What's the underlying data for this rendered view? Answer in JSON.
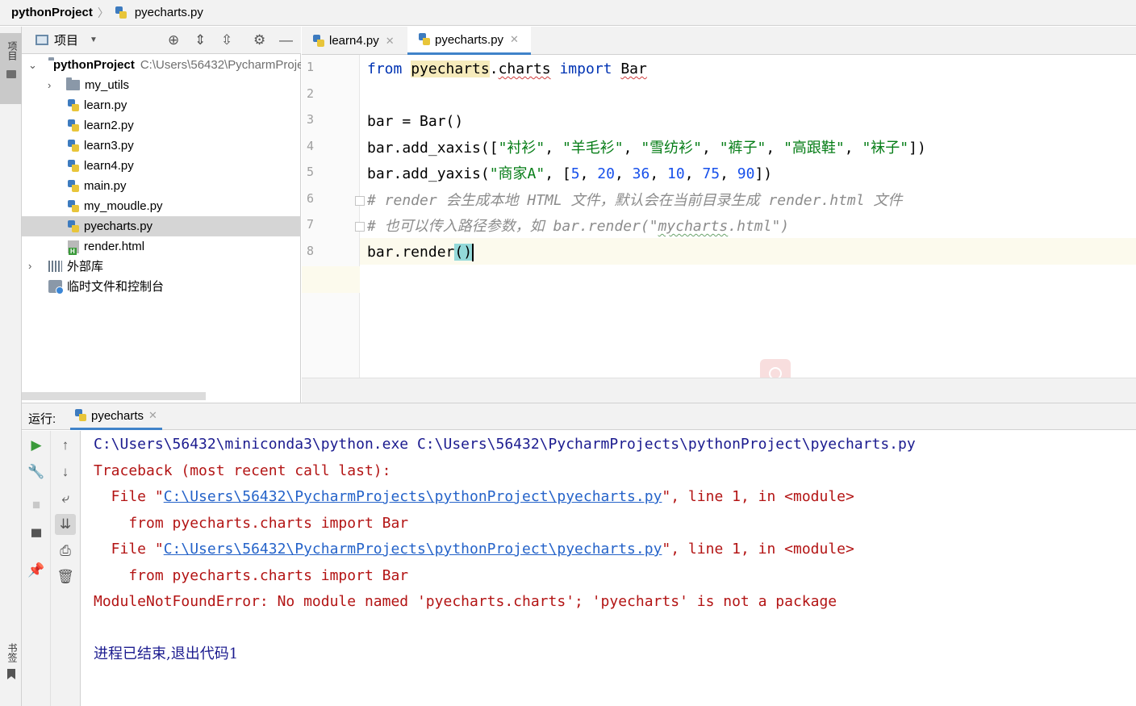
{
  "breadcrumb": {
    "project": "pythonProject",
    "file": "pyecharts.py"
  },
  "left_stripe": {
    "project_label": "项目",
    "bookmarks_label": "书签"
  },
  "project_panel": {
    "title": "项目",
    "tree": [
      {
        "label": "pythonProject",
        "path": "C:\\Users\\56432\\PycharmProjects\\pythonProject",
        "kind": "root"
      },
      {
        "label": "my_utils",
        "kind": "folder"
      },
      {
        "label": "learn.py",
        "kind": "py"
      },
      {
        "label": "learn2.py",
        "kind": "py"
      },
      {
        "label": "learn3.py",
        "kind": "py"
      },
      {
        "label": "learn4.py",
        "kind": "py"
      },
      {
        "label": "main.py",
        "kind": "py"
      },
      {
        "label": "my_moudle.py",
        "kind": "py"
      },
      {
        "label": "pyecharts.py",
        "kind": "py",
        "selected": true
      },
      {
        "label": "render.html",
        "kind": "html"
      },
      {
        "label": "外部库",
        "kind": "lib"
      },
      {
        "label": "临时文件和控制台",
        "kind": "scratch"
      }
    ]
  },
  "editor": {
    "tabs": [
      {
        "label": "learn4.py",
        "active": false
      },
      {
        "label": "pyecharts.py",
        "active": true
      }
    ],
    "line_numbers": [
      "1",
      "2",
      "3",
      "4",
      "5",
      "6",
      "7",
      "8"
    ],
    "code": {
      "l1_from": "from",
      "l1_module": "pyecharts",
      "l1_dot": ".",
      "l1_sub": "charts",
      "l1_import": "import",
      "l1_name": "Bar",
      "l3": "bar = Bar()",
      "l4_pre": "bar.add_xaxis([",
      "l4_s1": "\"衬衫\"",
      "l4_s2": "\"羊毛衫\"",
      "l4_s3": "\"雪纺衫\"",
      "l4_s4": "\"裤子\"",
      "l4_s5": "\"高跟鞋\"",
      "l4_s6": "\"袜子\"",
      "l4_sep": ", ",
      "l4_post": "])",
      "l5_pre": "bar.add_yaxis(",
      "l5_s1": "\"商家A\"",
      "l5_mid": ", [",
      "l5_n1": "5",
      "l5_n2": "20",
      "l5_n3": "36",
      "l5_n4": "10",
      "l5_n5": "75",
      "l5_n6": "90",
      "l5_post": "])",
      "l6": "# render 会生成本地 HTML 文件，默认会在当前目录生成 render.html 文件",
      "l7_pre": "# 也可以传入路径参数，如 bar.render(\"",
      "l7_word": "mycharts",
      "l7_post": ".html\")",
      "l8_pre": "bar.render",
      "l8_brace": "()"
    }
  },
  "run_panel": {
    "label": "运行:",
    "tab": "pyecharts",
    "output": {
      "cmd": "C:\\Users\\56432\\miniconda3\\python.exe C:\\Users\\56432\\PycharmProjects\\pythonProject\\pyecharts.py",
      "traceback": "Traceback (most recent call last):",
      "file_prefix": "  File \"",
      "file_link": "C:\\Users\\56432\\PycharmProjects\\pythonProject\\pyecharts.py",
      "file_suffix": "\", line 1, in <module>",
      "code_line": "    from pyecharts.charts import Bar",
      "error": "ModuleNotFoundError: No module named 'pyecharts.charts'; 'pyecharts' is not a package",
      "exit": "进程已结束,退出代码1"
    }
  }
}
